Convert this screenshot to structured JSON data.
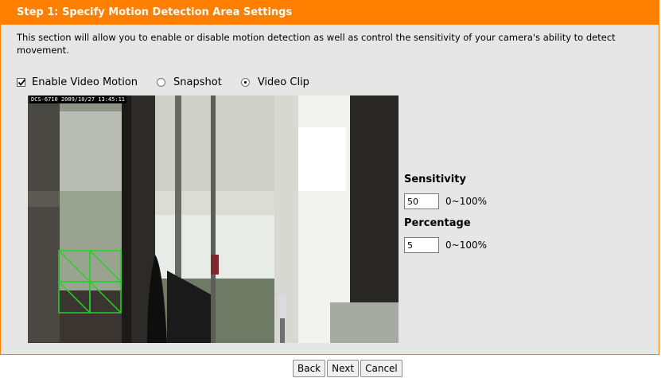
{
  "step_header": {
    "title": "Step 1: Specify Motion Detection Area Settings"
  },
  "description": "This section will allow you to enable or disable motion detection as well as control the sensitivity of your camera's ability to detect movement.",
  "options": {
    "enable_video_motion": {
      "label": "Enable Video Motion",
      "checked": true
    },
    "snapshot": {
      "label": "Snapshot",
      "selected": false
    },
    "video_clip": {
      "label": "Video Clip",
      "selected": true
    }
  },
  "video": {
    "osd_text": "DCS-6710  2009/10/27  13:45:11",
    "detection_grid": {
      "rows": 2,
      "cols": 2,
      "color": "#22d322"
    }
  },
  "sensitivity": {
    "label": "Sensitivity",
    "value": "50",
    "range": "0~100%"
  },
  "percentage": {
    "label": "Percentage",
    "value": "5",
    "range": "0~100%"
  },
  "buttons": {
    "back": "Back",
    "next": "Next",
    "cancel": "Cancel"
  },
  "colors": {
    "accent": "#ff7f00",
    "panel_bg": "#e6e6e6",
    "grid": "#22d322"
  }
}
